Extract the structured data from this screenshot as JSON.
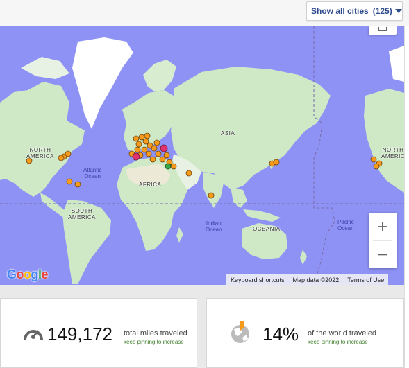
{
  "header": {
    "cities_button_label": "Show all cities",
    "cities_count": "(125)"
  },
  "map": {
    "labels": {
      "north_america": "NORTH\nAMERICA",
      "north_america_right": "NORTH\nAMERIC",
      "south_america": "SOUTH\nAMERICA",
      "africa": "AFRICA",
      "asia": "ASIA",
      "oceania": "OCEANIA",
      "atlantic": "Atlantic\nOcean",
      "indian": "Indian\nOcean",
      "pacific": "Pacific\nOcean"
    },
    "zoom_in": "+",
    "zoom_out": "−",
    "logo": "Google",
    "attribution": {
      "shortcuts": "Keyboard shortcuts",
      "map_data": "Map data ©2022",
      "terms": "Terms of Use"
    },
    "colors": {
      "ocean": "#8e92f5",
      "land": "#cfe8c6",
      "pin": "#f59a1a",
      "pin_highlight": "#e0336e",
      "pin_green": "#3aa64a"
    }
  },
  "stats": {
    "miles": {
      "value": "149,172",
      "label": "total miles traveled",
      "sub": "keep pinning to increase",
      "icon": "speedometer-icon"
    },
    "world": {
      "value": "14%",
      "label": "of the world traveled",
      "sub": "keep pinning to increase",
      "icon": "globe-pin-icon"
    }
  }
}
